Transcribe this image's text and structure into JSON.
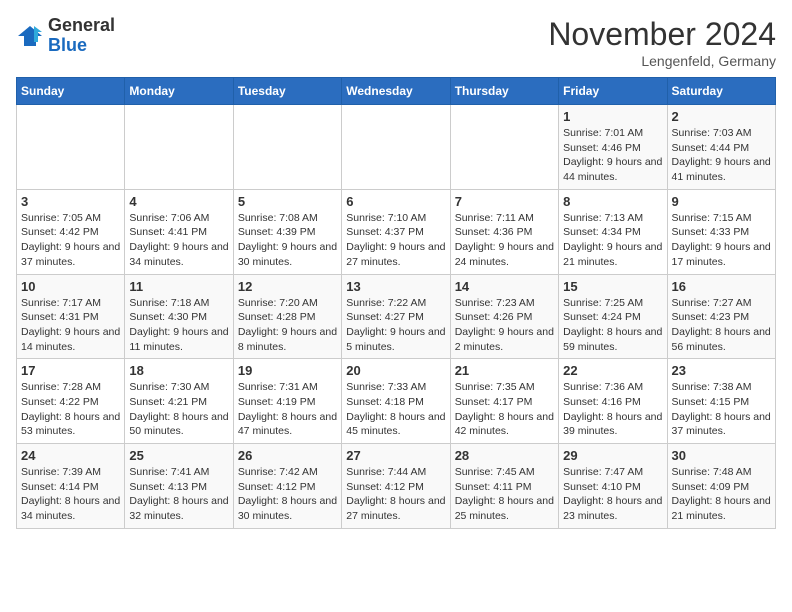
{
  "header": {
    "logo_general": "General",
    "logo_blue": "Blue",
    "month_title": "November 2024",
    "location": "Lengenfeld, Germany"
  },
  "columns": [
    "Sunday",
    "Monday",
    "Tuesday",
    "Wednesday",
    "Thursday",
    "Friday",
    "Saturday"
  ],
  "weeks": [
    [
      {
        "day": "",
        "info": ""
      },
      {
        "day": "",
        "info": ""
      },
      {
        "day": "",
        "info": ""
      },
      {
        "day": "",
        "info": ""
      },
      {
        "day": "",
        "info": ""
      },
      {
        "day": "1",
        "info": "Sunrise: 7:01 AM\nSunset: 4:46 PM\nDaylight: 9 hours and 44 minutes."
      },
      {
        "day": "2",
        "info": "Sunrise: 7:03 AM\nSunset: 4:44 PM\nDaylight: 9 hours and 41 minutes."
      }
    ],
    [
      {
        "day": "3",
        "info": "Sunrise: 7:05 AM\nSunset: 4:42 PM\nDaylight: 9 hours and 37 minutes."
      },
      {
        "day": "4",
        "info": "Sunrise: 7:06 AM\nSunset: 4:41 PM\nDaylight: 9 hours and 34 minutes."
      },
      {
        "day": "5",
        "info": "Sunrise: 7:08 AM\nSunset: 4:39 PM\nDaylight: 9 hours and 30 minutes."
      },
      {
        "day": "6",
        "info": "Sunrise: 7:10 AM\nSunset: 4:37 PM\nDaylight: 9 hours and 27 minutes."
      },
      {
        "day": "7",
        "info": "Sunrise: 7:11 AM\nSunset: 4:36 PM\nDaylight: 9 hours and 24 minutes."
      },
      {
        "day": "8",
        "info": "Sunrise: 7:13 AM\nSunset: 4:34 PM\nDaylight: 9 hours and 21 minutes."
      },
      {
        "day": "9",
        "info": "Sunrise: 7:15 AM\nSunset: 4:33 PM\nDaylight: 9 hours and 17 minutes."
      }
    ],
    [
      {
        "day": "10",
        "info": "Sunrise: 7:17 AM\nSunset: 4:31 PM\nDaylight: 9 hours and 14 minutes."
      },
      {
        "day": "11",
        "info": "Sunrise: 7:18 AM\nSunset: 4:30 PM\nDaylight: 9 hours and 11 minutes."
      },
      {
        "day": "12",
        "info": "Sunrise: 7:20 AM\nSunset: 4:28 PM\nDaylight: 9 hours and 8 minutes."
      },
      {
        "day": "13",
        "info": "Sunrise: 7:22 AM\nSunset: 4:27 PM\nDaylight: 9 hours and 5 minutes."
      },
      {
        "day": "14",
        "info": "Sunrise: 7:23 AM\nSunset: 4:26 PM\nDaylight: 9 hours and 2 minutes."
      },
      {
        "day": "15",
        "info": "Sunrise: 7:25 AM\nSunset: 4:24 PM\nDaylight: 8 hours and 59 minutes."
      },
      {
        "day": "16",
        "info": "Sunrise: 7:27 AM\nSunset: 4:23 PM\nDaylight: 8 hours and 56 minutes."
      }
    ],
    [
      {
        "day": "17",
        "info": "Sunrise: 7:28 AM\nSunset: 4:22 PM\nDaylight: 8 hours and 53 minutes."
      },
      {
        "day": "18",
        "info": "Sunrise: 7:30 AM\nSunset: 4:21 PM\nDaylight: 8 hours and 50 minutes."
      },
      {
        "day": "19",
        "info": "Sunrise: 7:31 AM\nSunset: 4:19 PM\nDaylight: 8 hours and 47 minutes."
      },
      {
        "day": "20",
        "info": "Sunrise: 7:33 AM\nSunset: 4:18 PM\nDaylight: 8 hours and 45 minutes."
      },
      {
        "day": "21",
        "info": "Sunrise: 7:35 AM\nSunset: 4:17 PM\nDaylight: 8 hours and 42 minutes."
      },
      {
        "day": "22",
        "info": "Sunrise: 7:36 AM\nSunset: 4:16 PM\nDaylight: 8 hours and 39 minutes."
      },
      {
        "day": "23",
        "info": "Sunrise: 7:38 AM\nSunset: 4:15 PM\nDaylight: 8 hours and 37 minutes."
      }
    ],
    [
      {
        "day": "24",
        "info": "Sunrise: 7:39 AM\nSunset: 4:14 PM\nDaylight: 8 hours and 34 minutes."
      },
      {
        "day": "25",
        "info": "Sunrise: 7:41 AM\nSunset: 4:13 PM\nDaylight: 8 hours and 32 minutes."
      },
      {
        "day": "26",
        "info": "Sunrise: 7:42 AM\nSunset: 4:12 PM\nDaylight: 8 hours and 30 minutes."
      },
      {
        "day": "27",
        "info": "Sunrise: 7:44 AM\nSunset: 4:12 PM\nDaylight: 8 hours and 27 minutes."
      },
      {
        "day": "28",
        "info": "Sunrise: 7:45 AM\nSunset: 4:11 PM\nDaylight: 8 hours and 25 minutes."
      },
      {
        "day": "29",
        "info": "Sunrise: 7:47 AM\nSunset: 4:10 PM\nDaylight: 8 hours and 23 minutes."
      },
      {
        "day": "30",
        "info": "Sunrise: 7:48 AM\nSunset: 4:09 PM\nDaylight: 8 hours and 21 minutes."
      }
    ]
  ]
}
